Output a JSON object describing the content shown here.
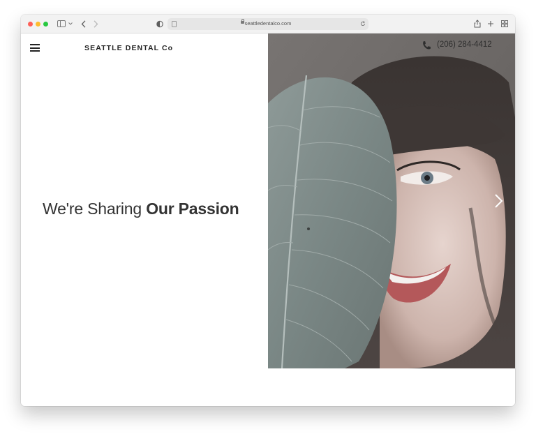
{
  "browser": {
    "url": "seattledentalco.com"
  },
  "site": {
    "logo": "SEATTLE DENTAL Co",
    "phone": "(206) 284-4412"
  },
  "hero": {
    "headline_light": "We're Sharing ",
    "headline_bold": "Our Passion"
  },
  "colors": {
    "accent_dark": "#222222",
    "hero_overlay": "#6d6a68"
  }
}
